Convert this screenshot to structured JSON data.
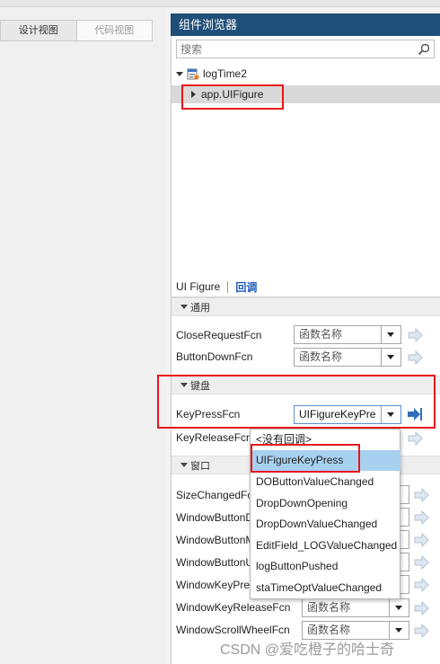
{
  "view_tabs": [
    "设计视图",
    "代码视图"
  ],
  "browser": {
    "title": "组件浏览器",
    "search_placeholder": "搜索",
    "root_node": "logTime2",
    "child_node": "app.UIFigure"
  },
  "inspector": {
    "tab_component": "UI Figure",
    "tab_callbacks": "回调"
  },
  "sections": {
    "general": "通用",
    "keyboard": "键盘",
    "window": "窗口"
  },
  "props": [
    {
      "label": "CloseRequestFcn",
      "value": "函数名称"
    },
    {
      "label": "ButtonDownFcn",
      "value": "函数名称"
    },
    {
      "label": "KeyPressFcn",
      "value": "UIFigureKeyPre"
    },
    {
      "label": "KeyReleaseFcn",
      "value": "<没有回调>"
    },
    {
      "label": "SizeChangedFcn",
      "value": ""
    },
    {
      "label": "WindowButtonDownFcn",
      "value": ""
    },
    {
      "label": "WindowButtonMotionFcn",
      "value": ""
    },
    {
      "label": "WindowButtonUpFcn",
      "value": ""
    },
    {
      "label": "WindowKeyPressFcn",
      "value": ""
    },
    {
      "label": "WindowKeyReleaseFcn",
      "value": "函数名称"
    },
    {
      "label": "WindowScrollWheelFcn",
      "value": "函数名称"
    }
  ],
  "dropdown_options": [
    "<没有回调>",
    "UIFigureKeyPress",
    "DOButtonValueChanged",
    "DropDownOpening",
    "DropDownValueChanged",
    "EditField_LOGValueChanged",
    "logButtonPushed",
    "staTimeOptValueChanged"
  ],
  "dropdown_selected": "UIFigureKeyPress",
  "watermark": "CSDN @爱吃橙子的哈士奇",
  "colors": {
    "title_bar": "#1f4e79",
    "selection": "#a8d1f0",
    "highlight_box": "#e8151b",
    "callbacks_tab": "#1a5bb8"
  }
}
